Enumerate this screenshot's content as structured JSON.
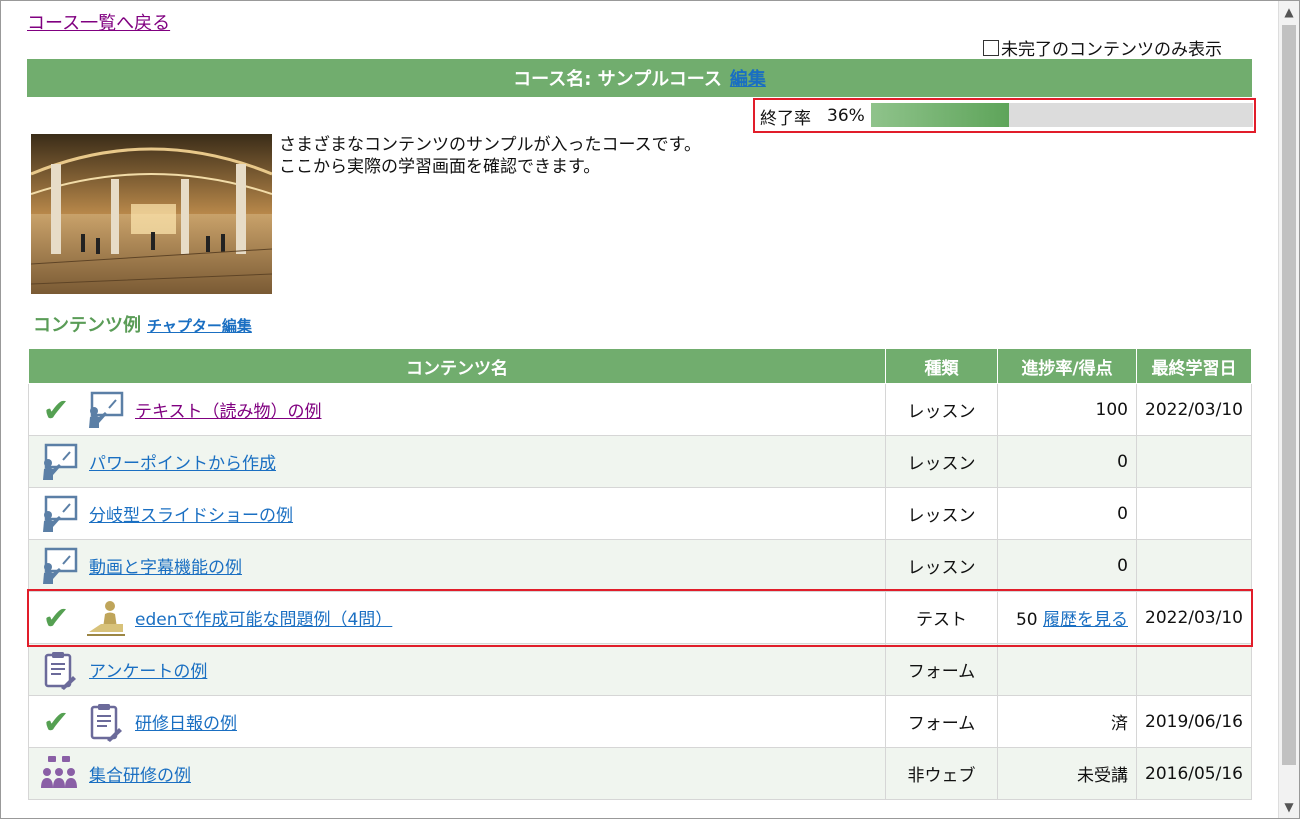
{
  "nav": {
    "back_label": "コース一覧へ戻る"
  },
  "filter": {
    "label": "未完了のコンテンツのみ表示"
  },
  "course": {
    "title": "コース名: サンプルコース",
    "edit_label": "編集",
    "progress_label": "終了率",
    "progress_text": "36%",
    "progress_value": 36,
    "description_line1": "さまざまなコンテンツのサンプルが入ったコースです。",
    "description_line2": "ここから実際の学習画面を確認できます。"
  },
  "section": {
    "title": "コンテンツ例",
    "chapter_edit_label": "チャプター編集"
  },
  "table": {
    "headers": {
      "name": "コンテンツ名",
      "type": "種類",
      "score": "進捗率/得点",
      "date": "最終学習日"
    },
    "rows": [
      {
        "name": "テキスト（読み物）の例",
        "type": "レッスン",
        "score": "100",
        "date": "2022/03/10",
        "done": true,
        "icon": "lesson-presentation-icon",
        "visited": true
      },
      {
        "name": "パワーポイントから作成",
        "type": "レッスン",
        "score": "0",
        "date": "",
        "done": false,
        "icon": "lesson-presentation-icon"
      },
      {
        "name": "分岐型スライドショーの例",
        "type": "レッスン",
        "score": "0",
        "date": "",
        "done": false,
        "icon": "lesson-presentation-icon"
      },
      {
        "name": "動画と字幕機能の例",
        "type": "レッスン",
        "score": "0",
        "date": "",
        "done": false,
        "icon": "lesson-presentation-icon"
      },
      {
        "name": "edenで作成可能な問題例（4問）",
        "type": "テスト",
        "score": "50",
        "history": "履歴を見る",
        "date": "2022/03/10",
        "done": true,
        "icon": "test-person-icon"
      },
      {
        "name": "アンケートの例",
        "type": "フォーム",
        "score": "",
        "date": "",
        "done": false,
        "icon": "clipboard-form-icon"
      },
      {
        "name": "研修日報の例",
        "type": "フォーム",
        "score": "済",
        "date": "2019/06/16",
        "done": true,
        "icon": "clipboard-form-icon"
      },
      {
        "name": "集合研修の例",
        "type": "非ウェブ",
        "score": "未受講",
        "date": "2016/05/16",
        "done": false,
        "icon": "group-training-icon"
      }
    ]
  },
  "colors": {
    "header_green": "#71ad6e",
    "highlight_red": "#e11d2a",
    "link_blue": "#1a6fc2",
    "check_green": "#55a052"
  }
}
